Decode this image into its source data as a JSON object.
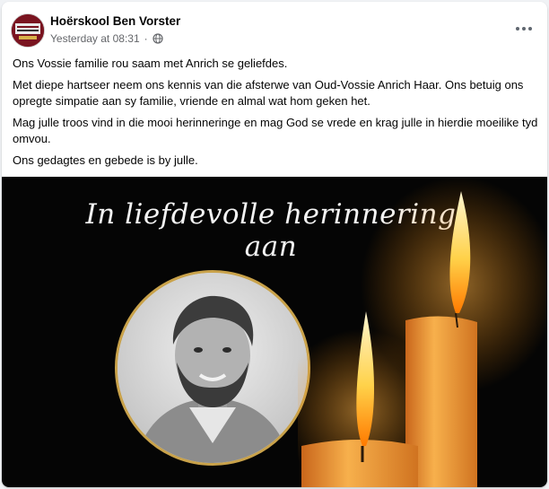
{
  "post": {
    "author": "Hoërskool Ben Vorster",
    "timestamp": "Yesterday at 08:31",
    "separator": "·",
    "audience_icon": "globe-icon",
    "more_icon": "more-options-icon",
    "paragraphs": [
      "Ons Vossie familie rou saam met Anrich se geliefdes.",
      "Met diepe hartseer neem ons  kennis van die afsterwe van Oud-Vossie Anrich Haar. Ons betuig ons opregte simpatie aan sy familie, vriende en almal wat hom geken het.",
      "Mag julle troos vind in die mooi herinneringe en mag God se vrede en krag julle in hierdie moeilike tyd omvou.",
      "Ons gedagtes en gebede is by julle."
    ]
  },
  "image": {
    "title": "In liefdevolle herinnering aan",
    "frame_color": "#c9a24a",
    "background": "#050505"
  }
}
